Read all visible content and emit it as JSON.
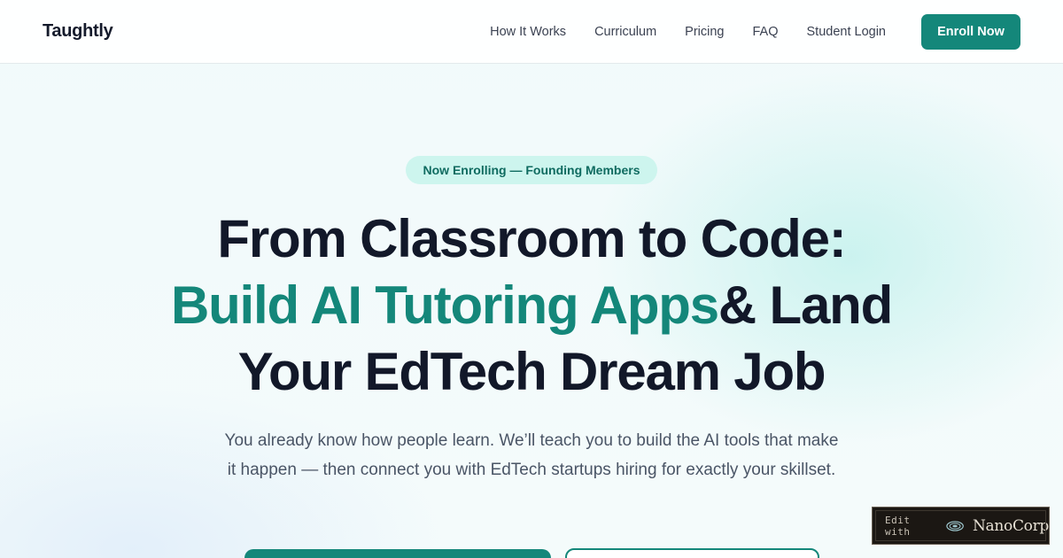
{
  "brand": {
    "name": "Taughtly"
  },
  "nav": {
    "links": [
      "How It Works",
      "Curriculum",
      "Pricing",
      "FAQ",
      "Student Login"
    ],
    "cta_label": "Enroll Now"
  },
  "hero": {
    "badge": "Now Enrolling — Founding Members",
    "headline_line1": "From Classroom to Code:",
    "headline_accent": "Build AI Tutoring Apps",
    "headline_line2_rest": "& Land",
    "headline_line3": "Your EdTech Dream Job",
    "subhead": "You already know how people learn. We’ll teach you to build the AI tools that make it happen — then connect you with EdTech startups hiring for exactly your skillset."
  },
  "edit_badge": {
    "prefix": "Edit with",
    "brand": "NanoCorp",
    "icon": "nanocorp-logo-icon"
  },
  "colors": {
    "accent": "#14877a",
    "heading": "#121829",
    "badge_bg": "#cdf5ee",
    "body_text": "#4a5566"
  }
}
